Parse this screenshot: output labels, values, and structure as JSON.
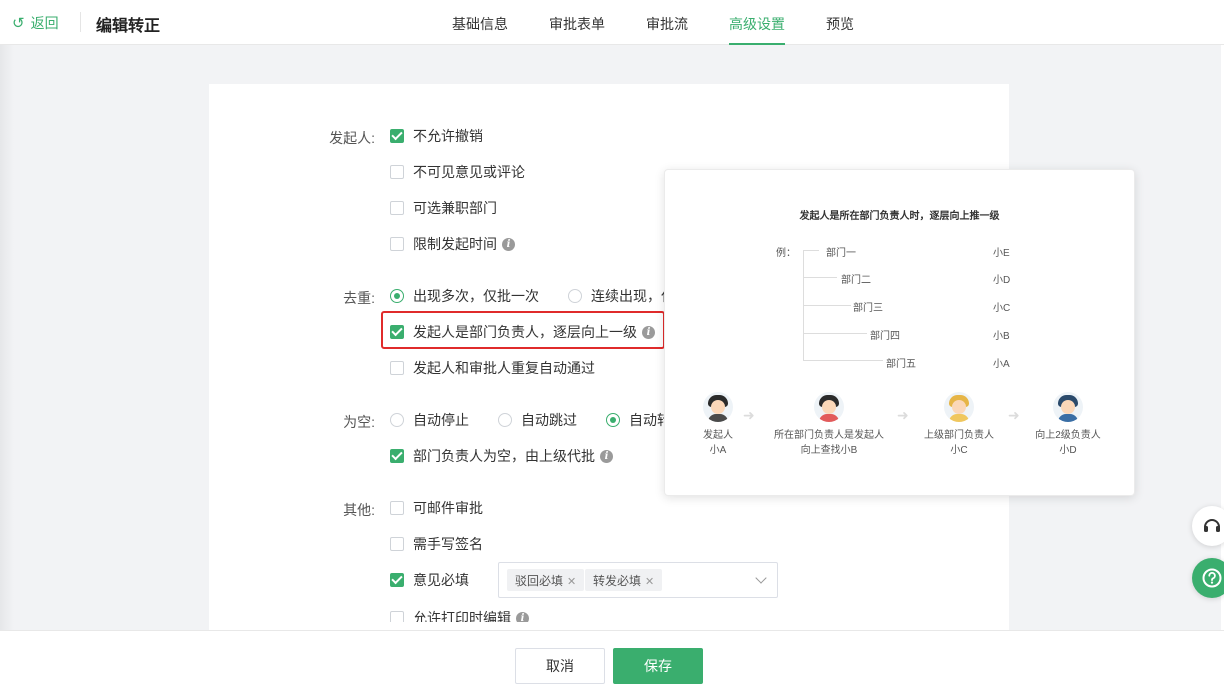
{
  "header": {
    "back_label": "返回",
    "title": "编辑转正",
    "tabs": [
      {
        "label": "基础信息",
        "active": false
      },
      {
        "label": "审批表单",
        "active": false
      },
      {
        "label": "审批流",
        "active": false
      },
      {
        "label": "高级设置",
        "active": true
      },
      {
        "label": "预览",
        "active": false
      }
    ]
  },
  "settings": {
    "initiator": {
      "label": "发起人:",
      "options": [
        {
          "text": "不允许撤销",
          "checked": true
        },
        {
          "text": "不可见意见或评论",
          "checked": false
        },
        {
          "text": "可选兼职部门",
          "checked": false
        },
        {
          "text": "限制发起时间",
          "checked": false
        }
      ]
    },
    "dedupe": {
      "label": "去重:",
      "radio_a": "出现多次，仅批一次",
      "radio_b": "连续出现，仅",
      "option_escalate": "发起人是部门负责人，逐层向上一级",
      "option_auto_pass": "发起人和审批人重复自动通过"
    },
    "empty": {
      "label": "为空:",
      "radio_stop": "自动停止",
      "radio_skip": "自动跳过",
      "radio_transfer": "自动转",
      "option_supervisor": "部门负责人为空，由上级代批"
    },
    "other": {
      "label": "其他:",
      "option_email": "可邮件审批",
      "option_signature": "需手写签名",
      "option_opinion": "意见必填",
      "option_print": "允许打印时编辑",
      "opinion_tags": [
        "驳回必填",
        "转发必填"
      ]
    }
  },
  "popover": {
    "title": "发起人是所在部门负责人时，逐层向上推一级",
    "example_label": "例：",
    "rows": [
      {
        "dept": "部门一",
        "person": "小E"
      },
      {
        "dept": "部门二",
        "person": "小D"
      },
      {
        "dept": "部门三",
        "person": "小C"
      },
      {
        "dept": "部门四",
        "person": "小B"
      },
      {
        "dept": "部门五",
        "person": "小A"
      }
    ],
    "flow": [
      {
        "line1": "发起人",
        "line2": "小A"
      },
      {
        "line1": "所在部门负责人是发起人",
        "line2": "向上查找小B"
      },
      {
        "line1": "上级部门负责人",
        "line2": "小C"
      },
      {
        "line1": "向上2级负责人",
        "line2": "小D"
      }
    ],
    "arrow_glyph": "➜"
  },
  "footer": {
    "cancel_label": "取消",
    "save_label": "保存"
  },
  "icons": {
    "back": "undo-arrow-icon",
    "info": "info-icon",
    "service": "headset-icon",
    "help": "help-icon"
  },
  "colors": {
    "accent": "#3aae6e",
    "highlight": "#e02b2b"
  }
}
